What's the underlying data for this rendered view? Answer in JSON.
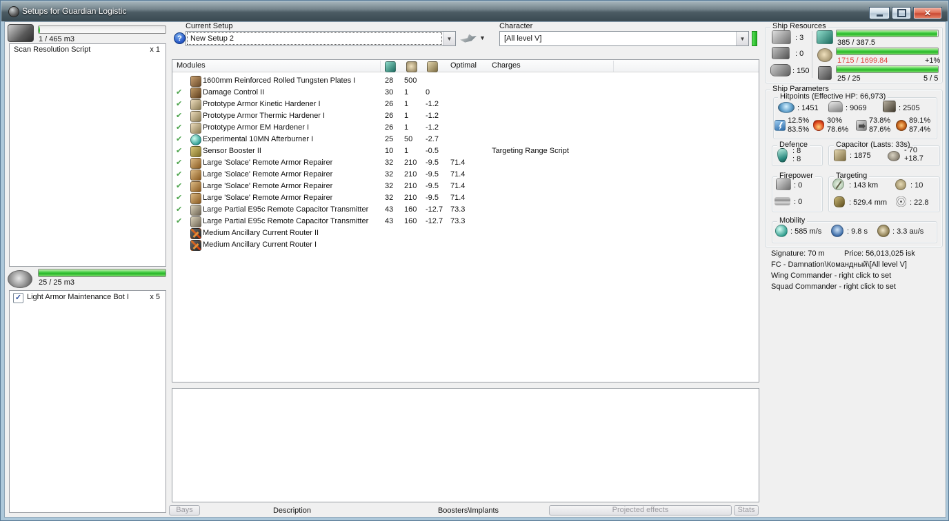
{
  "window": {
    "title": "Setups for Guardian Logistic"
  },
  "colors": {
    "bar_green": "#27b527",
    "over_limit_red": "#e04440",
    "check_green": "#4aa34a",
    "char_indicator_green": "#2fca2f"
  },
  "icons": {
    "cpu-icon": "teal chip square",
    "powergrid-icon": "tan atom blob",
    "capacitor-icon": "tan battery",
    "em-resist-icon": "blue lightning",
    "thermal-resist-icon": "red flame",
    "kinetic-resist-icon": "gray arrow",
    "explosive-resist-icon": "orange burst",
    "help-icon": "blue circle ?",
    "dropdown-arrow-icon": "▼",
    "active-check-icon": "green ✔",
    "close-icon": "✕",
    "minimize-icon": "—",
    "maximize-icon": "□"
  },
  "left_panel": {
    "cargo": {
      "capacity": "1 / 465 m3",
      "items": [
        {
          "name": "Scan Resolution Script",
          "qty": "x 1"
        }
      ]
    },
    "drones": {
      "capacity": "25 / 25 m3",
      "items": [
        {
          "name": "Light Armor Maintenance Bot I",
          "qty": "x 5",
          "checked": true
        }
      ]
    }
  },
  "toolbar": {
    "current_setup_label": "Current Setup",
    "current_setup_value": "New Setup 2",
    "character_label": "Character",
    "character_value": "[All level V]"
  },
  "modules_table": {
    "headers": {
      "modules": "Modules",
      "optimal": "Optimal",
      "charges": "Charges"
    },
    "rows": [
      {
        "active": false,
        "name": "1600mm Reinforced Rolled Tungsten Plates I",
        "cpu": "28",
        "pg": "500",
        "cap": "",
        "optimal": "",
        "charges": ""
      },
      {
        "active": true,
        "name": "Damage Control II",
        "cpu": "30",
        "pg": "1",
        "cap": "0",
        "optimal": "",
        "charges": ""
      },
      {
        "active": true,
        "name": "Prototype Armor Kinetic Hardener I",
        "cpu": "26",
        "pg": "1",
        "cap": "-1.2",
        "optimal": "",
        "charges": ""
      },
      {
        "active": true,
        "name": "Prototype Armor Thermic Hardener I",
        "cpu": "26",
        "pg": "1",
        "cap": "-1.2",
        "optimal": "",
        "charges": ""
      },
      {
        "active": true,
        "name": "Prototype Armor EM Hardener I",
        "cpu": "26",
        "pg": "1",
        "cap": "-1.2",
        "optimal": "",
        "charges": ""
      },
      {
        "active": true,
        "name": "Experimental 10MN Afterburner I",
        "cpu": "25",
        "pg": "50",
        "cap": "-2.7",
        "optimal": "",
        "charges": ""
      },
      {
        "active": true,
        "name": "Sensor Booster II",
        "cpu": "10",
        "pg": "1",
        "cap": "-0.5",
        "optimal": "",
        "charges": "Targeting Range Script"
      },
      {
        "active": true,
        "name": "Large 'Solace' Remote Armor Repairer",
        "cpu": "32",
        "pg": "210",
        "cap": "-9.5",
        "optimal": "71.4",
        "charges": ""
      },
      {
        "active": true,
        "name": "Large 'Solace' Remote Armor Repairer",
        "cpu": "32",
        "pg": "210",
        "cap": "-9.5",
        "optimal": "71.4",
        "charges": ""
      },
      {
        "active": true,
        "name": "Large 'Solace' Remote Armor Repairer",
        "cpu": "32",
        "pg": "210",
        "cap": "-9.5",
        "optimal": "71.4",
        "charges": ""
      },
      {
        "active": true,
        "name": "Large 'Solace' Remote Armor Repairer",
        "cpu": "32",
        "pg": "210",
        "cap": "-9.5",
        "optimal": "71.4",
        "charges": ""
      },
      {
        "active": true,
        "name": "Large Partial E95c Remote Capacitor Transmitter",
        "cpu": "43",
        "pg": "160",
        "cap": "-12.7",
        "optimal": "73.3",
        "charges": ""
      },
      {
        "active": true,
        "name": "Large Partial E95c Remote Capacitor Transmitter",
        "cpu": "43",
        "pg": "160",
        "cap": "-12.7",
        "optimal": "73.3",
        "charges": ""
      },
      {
        "active": false,
        "name": "Medium Ancillary Current Router II",
        "cpu": "",
        "pg": "",
        "cap": "",
        "optimal": "",
        "charges": ""
      },
      {
        "active": false,
        "name": "Medium Ancillary Current Router I",
        "cpu": "",
        "pg": "",
        "cap": "",
        "optimal": "",
        "charges": ""
      }
    ]
  },
  "bottom_bar": {
    "bays": "Bays",
    "description": "Description",
    "boosters_implants": "Boosters\\Implants",
    "projected_effects": "Projected effects",
    "stats": "Stats"
  },
  "ship_resources": {
    "title": "Ship Resources",
    "turrets": ": 3",
    "launchers": ": 0",
    "calibration": ": 150",
    "cpu": "385 / 387.5",
    "powergrid": "1715 / 1699.84",
    "powergrid_over": "+1%",
    "dronebay": "25 / 25",
    "drones_active": "5 / 5"
  },
  "ship_parameters": {
    "title": "Ship Parameters",
    "hitpoints": {
      "title": "Hitpoints (Effective HP: 66,973)",
      "shield": ": 1451",
      "armor": ": 9069",
      "structure": ": 2505",
      "resists": [
        {
          "kind": "em",
          "top": "12.5%",
          "bottom": "83.5%"
        },
        {
          "kind": "thermal",
          "top": "30%",
          "bottom": "78.6%"
        },
        {
          "kind": "kinetic",
          "top": "73.8%",
          "bottom": "87.6%"
        },
        {
          "kind": "explosive",
          "top": "89.1%",
          "bottom": "87.4%"
        }
      ]
    },
    "defence": {
      "title": "Defence",
      "v1": ": 8",
      "v2": ": 8"
    },
    "capacitor": {
      "title": "Capacitor (Lasts: 33s)",
      "amount": ": 1875",
      "delta_top": "- 70",
      "delta_bottom": "+18.7"
    },
    "firepower": {
      "title": "Firepower",
      "turret": ": 0",
      "missile": ": 0"
    },
    "targeting": {
      "title": "Targeting",
      "range": ": 143 km",
      "max_targets": ": 10",
      "sensor_strength": ": 529.4 mm",
      "scan_resolution": ": 22.8"
    },
    "mobility": {
      "title": "Mobility",
      "speed": ": 585 m/s",
      "align": ": 9.8 s",
      "warp": ": 3.3 au/s"
    },
    "signature": "Signature: 70 m",
    "price": "Price: 56,013,025 isk",
    "fc": "FC - Damnation\\Командный\\[All level V]",
    "wing": "Wing Commander - right click to set",
    "squad": "Squad Commander - right click to set"
  }
}
